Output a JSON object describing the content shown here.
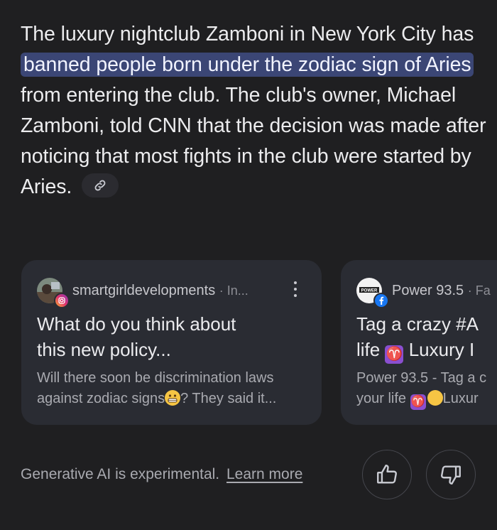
{
  "answer": {
    "text_before": "The luxury nightclub Zamboni in New York City has ",
    "highlight": "banned people born under the zodiac sign of Aries",
    "text_after": " from entering the club. The club's owner, Michael Zamboni, told CNN that the decision was made after noticing that most fights in the club were started by Aries.",
    "link_chip_icon": "link-icon"
  },
  "cards": [
    {
      "source_name": "smartgirldevelopments",
      "source_meta": "· In...",
      "badge_icon": "instagram-icon",
      "title": "What do you think about\nthis new policy...",
      "snippet_before": "Will there soon be discrimination laws\nagainst zodiac signs",
      "snippet_emoji": "grimacing-face-emoji",
      "snippet_after": "? They said it..."
    },
    {
      "source_name": "Power 93.5",
      "source_meta": "· Fa",
      "badge_icon": "facebook-icon",
      "title_line1": "Tag a crazy #A",
      "title_line2_before": "life ",
      "title_aries": "♈",
      "title_line2_after": " Luxury I",
      "snippet_line1": "Power 93.5 - Tag a c",
      "snippet_line2_before": "your life ",
      "snippet_aries": "♈",
      "snippet_line2_after": "Luxur"
    }
  ],
  "footer": {
    "disclaimer": "Generative AI is experimental.",
    "learn_more": "Learn more"
  },
  "colors": {
    "background": "#1f1f21",
    "highlight": "#3b4675",
    "card": "#2a2c33"
  }
}
